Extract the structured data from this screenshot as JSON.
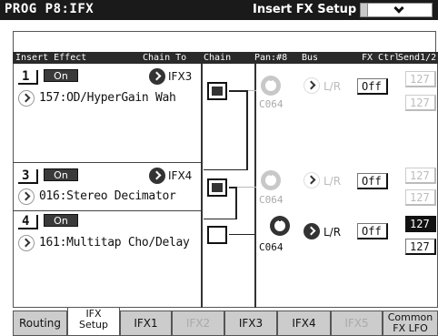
{
  "header": {
    "mode": "PROG P8:IFX",
    "page_title": "Insert FX Setup"
  },
  "columns": {
    "insert_effect": "Insert Effect",
    "chain_to": "Chain To",
    "chain": "Chain",
    "pan": "Pan:#8",
    "bus": "Bus",
    "fx_ctrl": "FX Ctrl",
    "send": "Send1/2"
  },
  "slots": [
    {
      "number": "1",
      "on_label": "On",
      "chain_to": "IFX3",
      "effect": "157:OD/HyperGain Wah",
      "chain_on": true,
      "pan": "C064",
      "bus": "L/R",
      "fx_ctrl": "Off",
      "send1": "127",
      "send2": "127",
      "enabled": false
    },
    {
      "number": "3",
      "on_label": "On",
      "chain_to": "IFX4",
      "effect": "016:Stereo Decimator",
      "chain_on": true,
      "pan": "C064",
      "bus": "L/R",
      "fx_ctrl": "Off",
      "send1": "127",
      "send2": "127",
      "enabled": false
    },
    {
      "number": "4",
      "on_label": "On",
      "chain_to": "",
      "effect": "161:Multitap Cho/Delay",
      "chain_on": false,
      "pan": "C064",
      "bus": "L/R",
      "fx_ctrl": "Off",
      "send1": "127",
      "send2": "127",
      "enabled": true
    }
  ],
  "tabs": [
    {
      "label": "Routing",
      "state": "normal"
    },
    {
      "label": "IFX Setup",
      "line1": "IFX",
      "line2": "Setup",
      "state": "active"
    },
    {
      "label": "IFX1",
      "state": "normal"
    },
    {
      "label": "IFX2",
      "state": "disabled"
    },
    {
      "label": "IFX3",
      "state": "normal"
    },
    {
      "label": "IFX4",
      "state": "normal"
    },
    {
      "label": "IFX5",
      "state": "disabled"
    },
    {
      "label": "Common FX LFO",
      "line1": "Common",
      "line2": "FX LFO",
      "state": "normal"
    }
  ],
  "colors": {
    "title_bar": "#1a1a1a",
    "selected_field": "#111111",
    "tab_background": "#cccccc",
    "disabled_text": "#aaaaaa"
  }
}
